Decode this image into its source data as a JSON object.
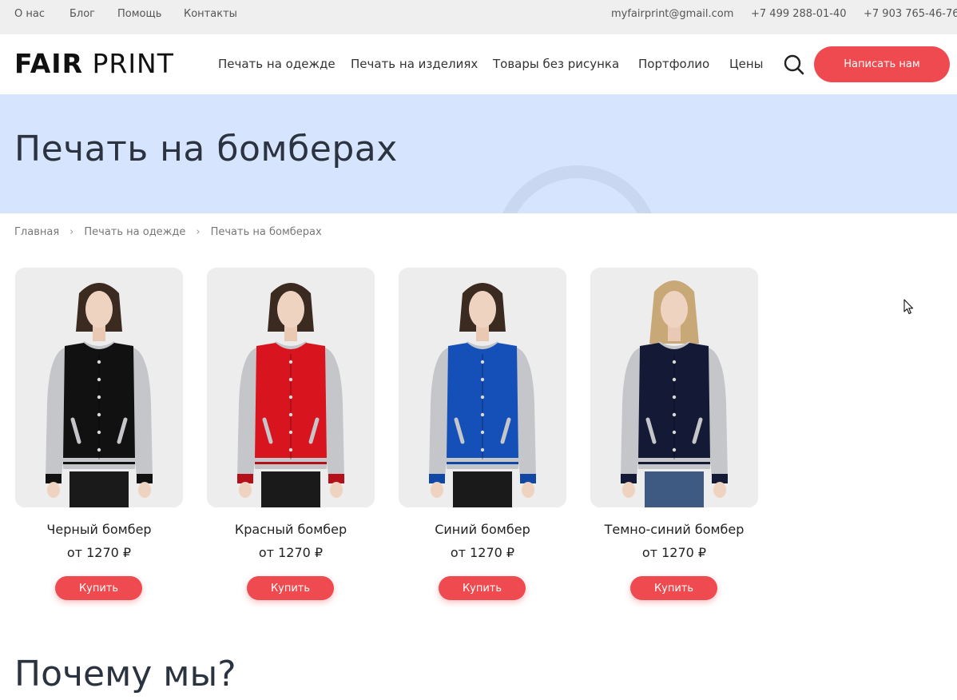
{
  "topbar": {
    "links": [
      "О нас",
      "Блог",
      "Помощь",
      "Контакты"
    ],
    "email": "myfairprint@gmail.com",
    "phone1": "+7 499 288-01-40",
    "phone2": "+7 903 765-46-76"
  },
  "header": {
    "logo_bold": "FAIR",
    "logo_light": "PRINT",
    "nav": [
      "Печать на одежде",
      "Печать на изделиях",
      "Товары без рисунка",
      "Портфолио",
      "Цены"
    ],
    "search_icon": "search-icon",
    "cta_label": "Написать нам"
  },
  "hero": {
    "title": "Печать на бомберах"
  },
  "breadcrumb": [
    "Главная",
    "Печать на одежде",
    "Печать на бомберах"
  ],
  "products": [
    {
      "name": "Черный бомбер",
      "price": "от 1270 ₽",
      "buy_label": "Купить",
      "body_color": "#111111",
      "trim_color": "#111111"
    },
    {
      "name": "Красный бомбер",
      "price": "от 1270 ₽",
      "buy_label": "Купить",
      "body_color": "#d8141e",
      "trim_color": "#b5101a"
    },
    {
      "name": "Синий бомбер",
      "price": "от 1270 ₽",
      "buy_label": "Купить",
      "body_color": "#1450b8",
      "trim_color": "#1248a5"
    },
    {
      "name": "Темно-синий бомбер",
      "price": "от 1270 ₽",
      "buy_label": "Купить",
      "body_color": "#141a35",
      "trim_color": "#141a35"
    }
  ],
  "section": {
    "why_title": "Почему мы?"
  },
  "colors": {
    "accent": "#ef4a4f",
    "hero_bg": "#d6e4fd",
    "topbar_bg": "#efefef"
  }
}
